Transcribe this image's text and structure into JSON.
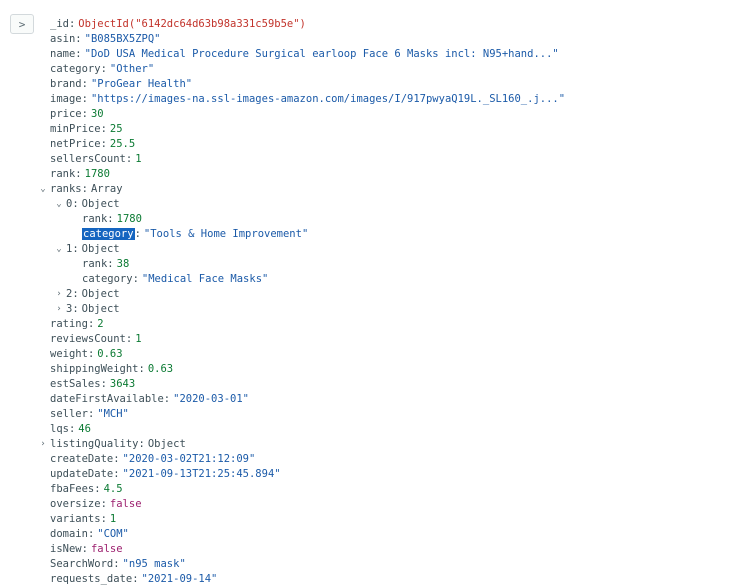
{
  "expand_glyph": ">",
  "rows": [
    {
      "key": "_id",
      "value": "ObjectId(\"6142dc64d63b98a331c59b5e\")",
      "type": "oid",
      "depth": 0
    },
    {
      "key": "asin",
      "value": "\"B085BX5ZPQ\"",
      "type": "str",
      "depth": 0
    },
    {
      "key": "name",
      "value": "\"DoD USA Medical Procedure Surgical earloop Face 6 Masks incl: N95+hand...\"",
      "type": "str",
      "depth": 0
    },
    {
      "key": "category",
      "value": "\"Other\"",
      "type": "str",
      "depth": 0
    },
    {
      "key": "brand",
      "value": "\"ProGear Health\"",
      "type": "str",
      "depth": 0
    },
    {
      "key": "image",
      "value": "\"https://images-na.ssl-images-amazon.com/images/I/917pwyaQ19L._SL160_.j...\"",
      "type": "str",
      "depth": 0
    },
    {
      "key": "price",
      "value": "30",
      "type": "num",
      "depth": 0
    },
    {
      "key": "minPrice",
      "value": "25",
      "type": "num",
      "depth": 0
    },
    {
      "key": "netPrice",
      "value": "25.5",
      "type": "num",
      "depth": 0
    },
    {
      "key": "sellersCount",
      "value": "1",
      "type": "num",
      "depth": 0
    },
    {
      "key": "rank",
      "value": "1780",
      "type": "num",
      "depth": 0
    },
    {
      "key": "ranks",
      "value": "Array",
      "type": "type",
      "depth": 0,
      "caret": "down"
    },
    {
      "key": "0",
      "value": "Object",
      "type": "type",
      "depth": 1,
      "caret": "down"
    },
    {
      "key": "rank",
      "value": "1780",
      "type": "num",
      "depth": 2
    },
    {
      "key": "category",
      "value": "\"Tools & Home Improvement\"",
      "type": "str",
      "depth": 2,
      "highlight": true
    },
    {
      "key": "1",
      "value": "Object",
      "type": "type",
      "depth": 1,
      "caret": "down"
    },
    {
      "key": "rank",
      "value": "38",
      "type": "num",
      "depth": 2
    },
    {
      "key": "category",
      "value": "\"Medical Face Masks\"",
      "type": "str",
      "depth": 2
    },
    {
      "key": "2",
      "value": "Object",
      "type": "type",
      "depth": 1,
      "caret": "right"
    },
    {
      "key": "3",
      "value": "Object",
      "type": "type",
      "depth": 1,
      "caret": "right"
    },
    {
      "key": "rating",
      "value": "2",
      "type": "num",
      "depth": 0
    },
    {
      "key": "reviewsCount",
      "value": "1",
      "type": "num",
      "depth": 0
    },
    {
      "key": "weight",
      "value": "0.63",
      "type": "num",
      "depth": 0
    },
    {
      "key": "shippingWeight",
      "value": "0.63",
      "type": "num",
      "depth": 0
    },
    {
      "key": "estSales",
      "value": "3643",
      "type": "num",
      "depth": 0
    },
    {
      "key": "dateFirstAvailable",
      "value": "\"2020-03-01\"",
      "type": "str",
      "depth": 0
    },
    {
      "key": "seller",
      "value": "\"MCH\"",
      "type": "str",
      "depth": 0
    },
    {
      "key": "lqs",
      "value": "46",
      "type": "num",
      "depth": 0
    },
    {
      "key": "listingQuality",
      "value": "Object",
      "type": "type",
      "depth": 0,
      "caret": "right"
    },
    {
      "key": "createDate",
      "value": "\"2020-03-02T21:12:09\"",
      "type": "str",
      "depth": 0
    },
    {
      "key": "updateDate",
      "value": "\"2021-09-13T21:25:45.894\"",
      "type": "str",
      "depth": 0
    },
    {
      "key": "fbaFees",
      "value": "4.5",
      "type": "num",
      "depth": 0
    },
    {
      "key": "oversize",
      "value": "false",
      "type": "bool",
      "depth": 0
    },
    {
      "key": "variants",
      "value": "1",
      "type": "num",
      "depth": 0
    },
    {
      "key": "domain",
      "value": "\"COM\"",
      "type": "str",
      "depth": 0
    },
    {
      "key": "isNew",
      "value": "false",
      "type": "bool",
      "depth": 0
    },
    {
      "key": "SearchWord",
      "value": "\"n95 mask\"",
      "type": "str",
      "depth": 0
    },
    {
      "key": "requests_date",
      "value": "\"2021-09-14\"",
      "type": "str",
      "depth": 0
    }
  ]
}
